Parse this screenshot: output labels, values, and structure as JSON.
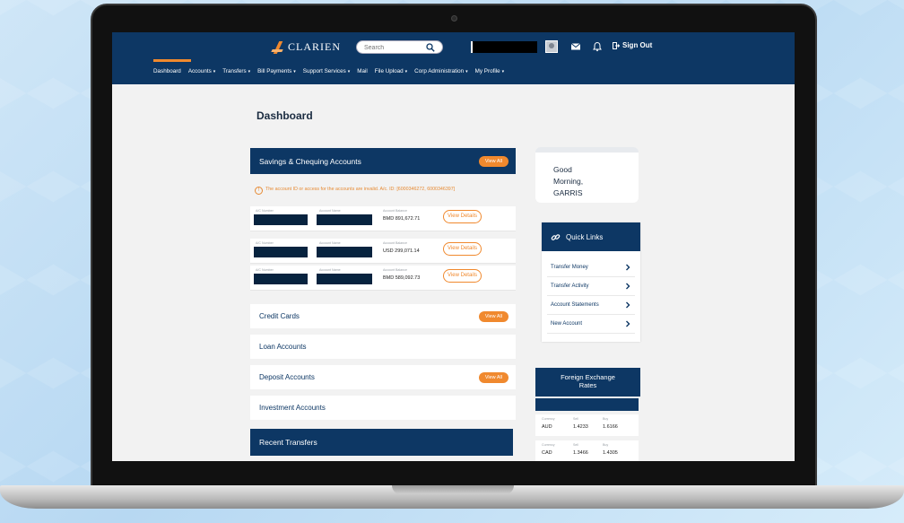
{
  "brand": {
    "name": "CLARIEN",
    "accent": "#f0892e",
    "navy": "#0d3764"
  },
  "header": {
    "search_placeholder": "Search",
    "sign_out_label": "Sign Out"
  },
  "nav": {
    "items": [
      {
        "label": "Dashboard",
        "caret": false
      },
      {
        "label": "Accounts",
        "caret": true
      },
      {
        "label": "Transfers",
        "caret": true
      },
      {
        "label": "Bill Payments",
        "caret": true
      },
      {
        "label": "Support Services",
        "caret": true
      },
      {
        "label": "Mail",
        "caret": false
      },
      {
        "label": "File Upload",
        "caret": true
      },
      {
        "label": "Corp Administration",
        "caret": true
      },
      {
        "label": "My Profile",
        "caret": true
      }
    ],
    "active": "Dashboard"
  },
  "page": {
    "title": "Dashboard"
  },
  "savings": {
    "title": "Savings & Chequing Accounts",
    "view_all": "View All",
    "warning": "The account ID or access for the accounts are invalid. A/c. ID: [6000346272, 6000346397]",
    "accounts": [
      {
        "ac_label": "A/C Number",
        "name_label": "Account Name",
        "balance_label": "Account Balance",
        "balance": "BMD 891,672.71",
        "action": "View Details"
      },
      {
        "ac_label": "A/C Number",
        "name_label": "Account Name",
        "balance_label": "Account Balance",
        "balance": "USD 299,071.14",
        "action": "View Details"
      },
      {
        "ac_label": "A/C Number",
        "name_label": "Account Name",
        "balance_label": "Account Balance",
        "balance": "BMD 589,092.73",
        "action": "View Details"
      }
    ]
  },
  "cards": [
    {
      "label": "Credit Cards",
      "view_all": "View All"
    },
    {
      "label": "Loan Accounts",
      "view_all": ""
    },
    {
      "label": "Deposit Accounts",
      "view_all": "View All"
    },
    {
      "label": "Investment Accounts",
      "view_all": ""
    }
  ],
  "recent_transfers": {
    "title": "Recent Transfers"
  },
  "greeting": {
    "line1": "Good",
    "line2": "Morning,",
    "line3": "GARRIS"
  },
  "quick_links": {
    "title": "Quick Links",
    "items": [
      "Transfer Money",
      "Transfer Activity",
      "Account Statements",
      "New Account"
    ]
  },
  "fx": {
    "title_line1": "Foreign Exchange",
    "title_line2": "Rates",
    "rows": [
      {
        "currency_label": "Currency",
        "sell_label": "Sell",
        "buy_label": "Buy",
        "currency": "AUD",
        "sell": "1.4233",
        "buy": "1.6166"
      },
      {
        "currency_label": "Currency",
        "sell_label": "Sell",
        "buy_label": "Buy",
        "currency": "CAD",
        "sell": "1.3466",
        "buy": "1.4305"
      }
    ]
  }
}
